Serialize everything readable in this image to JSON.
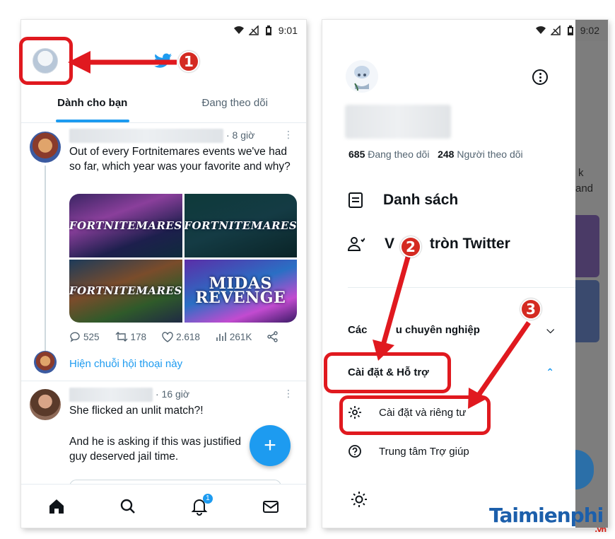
{
  "left": {
    "status_time": "9:01",
    "tabs": [
      {
        "label": "Dành cho bạn",
        "active": true
      },
      {
        "label": "Đang theo dõi",
        "active": false
      }
    ],
    "tweet1": {
      "time": "· 8 giờ",
      "text": "Out of every Fortnitemares events we've had so far, which year was your favorite and why?",
      "media": [
        "FORTNITEMARES",
        "FORTNITEMARES",
        "FORTNITEMARES",
        "MIDAS REVENGE"
      ],
      "replies": "525",
      "retweets": "178",
      "likes": "2.618",
      "views": "261K"
    },
    "show_thread": "Hiện chuỗi hội thoại này",
    "tweet2": {
      "time": "· 16 giờ",
      "line1": "She flicked an unlit match?!",
      "line2": "And he is asking if this was justified",
      "line3": "guy deserved jail time."
    },
    "fab_label": "+",
    "notification_badge": "1"
  },
  "right": {
    "status_time": "9:02",
    "following_count": "685",
    "following_label": "Đang theo dõi",
    "followers_count": "248",
    "followers_label": "Người theo dõi",
    "menu": [
      {
        "label": "Danh sách",
        "icon": "list-icon"
      },
      {
        "label": "V",
        "label_rest": " tròn Twitter",
        "icon": "people-icon"
      }
    ],
    "section_pro_prefix": "Các ",
    "section_pro_suffix": "u chuyên nghiệp",
    "section_settings": "Cài đặt & Hỗ trợ",
    "sub_items": [
      {
        "label": "Cài đặt và riêng tư",
        "icon": "gear-icon"
      },
      {
        "label": "Trung tâm Trợ giúp",
        "icon": "help-icon"
      }
    ],
    "behind_text": [
      "k",
      "and"
    ]
  },
  "annotations": [
    "1",
    "2",
    "3"
  ],
  "watermark": {
    "brand": "Taimienphi",
    "tld": ".vn"
  },
  "colors": {
    "accent": "#1d9bf0",
    "annotation": "#e0191f",
    "text": "#0f1419",
    "muted": "#536471"
  }
}
